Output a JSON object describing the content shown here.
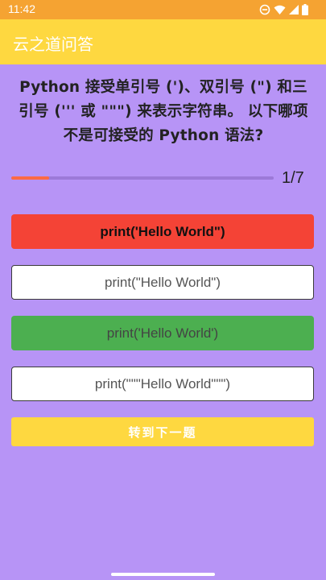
{
  "status_bar": {
    "time": "11:42"
  },
  "app_bar": {
    "title": "云之道问答"
  },
  "question": {
    "text": "Python 接受单引号 (')、双引号 (\") 和三引号 (''' 或 \"\"\") 来表示字符串。 以下哪项不是可接受的 Python 语法?"
  },
  "progress": {
    "text": "1/7",
    "fraction": 0.1428
  },
  "options": [
    {
      "label": "print('Hello World\")",
      "state": "wrong"
    },
    {
      "label": "print(\"Hello World\")",
      "state": "plain"
    },
    {
      "label": "print('Hello World')",
      "state": "correct"
    },
    {
      "label": "print(\"\"\"Hello World\"\"\")",
      "state": "plain"
    }
  ],
  "next_button": {
    "label": "转到下一题"
  },
  "colors": {
    "background": "#b794f6",
    "status_bar": "#f5a332",
    "app_bar": "#fed840",
    "wrong": "#f44336",
    "correct": "#4caf50",
    "progress_fill": "#ff6a44"
  }
}
